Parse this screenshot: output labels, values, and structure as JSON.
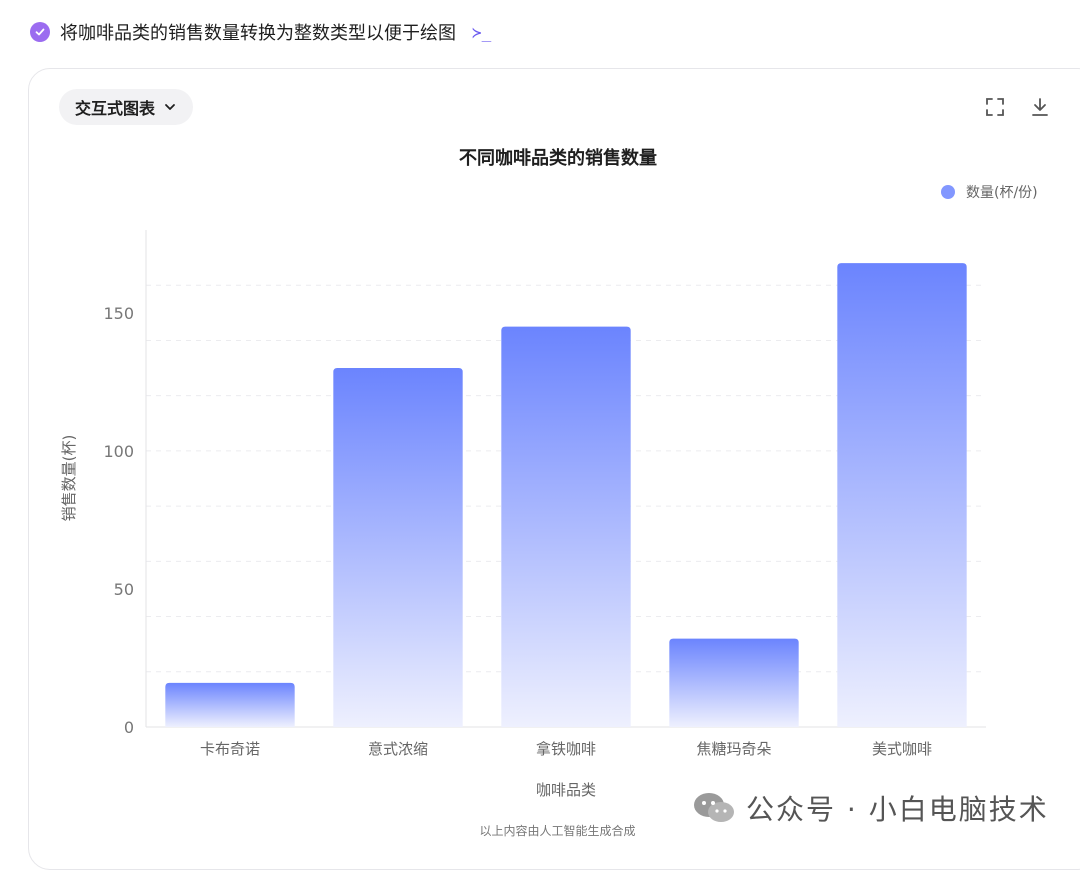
{
  "status": {
    "text": "将咖啡品类的销售数量转换为整数类型以便于绘图",
    "terminal_glyph": "≻_"
  },
  "toolbar": {
    "chart_type_label": "交互式图表",
    "fullscreen_icon": "fullscreen-icon",
    "download_icon": "download-icon"
  },
  "chart_data": {
    "type": "bar",
    "title": "不同咖啡品类的销售数量",
    "xlabel": "咖啡品类",
    "ylabel": "销售数量(杯)",
    "categories": [
      "卡布奇诺",
      "意式浓缩",
      "拿铁咖啡",
      "焦糖玛奇朵",
      "美式咖啡"
    ],
    "series": [
      {
        "name": "数量(杯/份)",
        "values": [
          16,
          130,
          145,
          32,
          168
        ]
      }
    ],
    "ylim": [
      0,
      180
    ],
    "yticks": [
      0,
      50,
      100,
      150
    ],
    "grid": true,
    "legend_position": "top-right",
    "colors": {
      "bar_top": "#6b84fe",
      "bar_bottom": "#eef0fe",
      "legend_dot": "#8297ff"
    }
  },
  "watermark": {
    "text": "公众号 · 小白电脑技术"
  },
  "footer": {
    "note": "以上内容由人工智能生成合成"
  }
}
